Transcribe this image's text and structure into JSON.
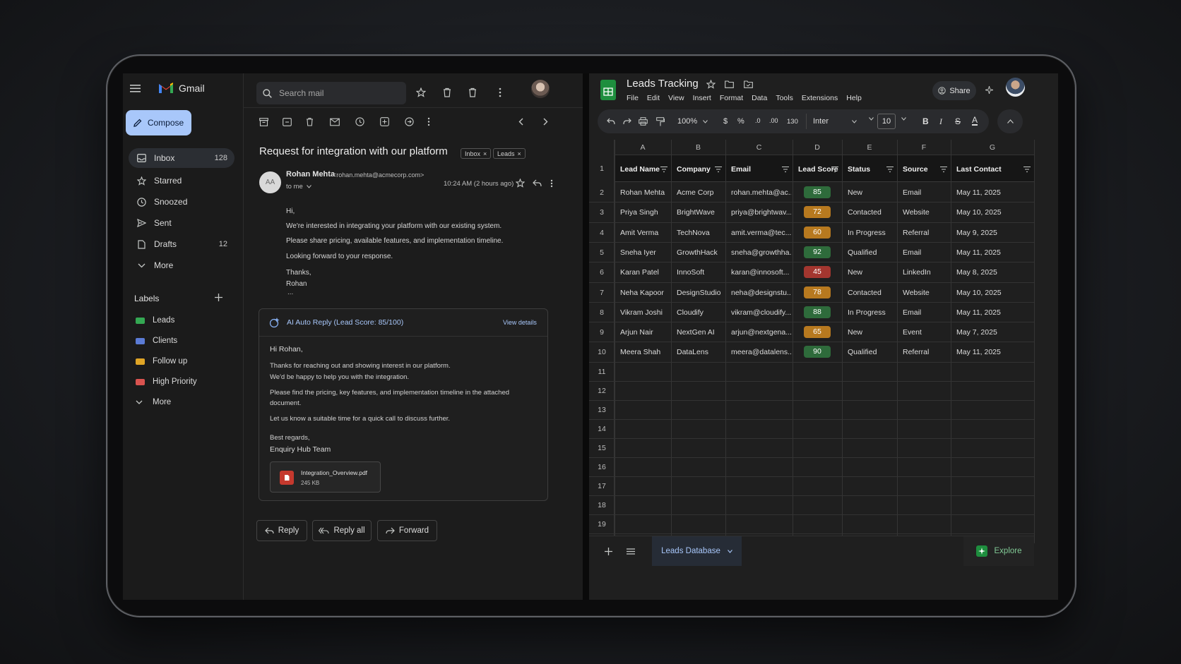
{
  "gmail": {
    "app_name": "Gmail",
    "compose_label": "Compose",
    "search_placeholder": "Search mail",
    "nav": [
      {
        "label": "Inbox",
        "count": "128",
        "icon": "inbox-icon"
      },
      {
        "label": "Starred",
        "count": "",
        "icon": "star-icon"
      },
      {
        "label": "Snoozed",
        "count": "",
        "icon": "clock-icon"
      },
      {
        "label": "Sent",
        "count": "",
        "icon": "send-icon"
      },
      {
        "label": "Drafts",
        "count": "12",
        "icon": "draft-icon"
      },
      {
        "label": "More",
        "count": "",
        "icon": "chevron-down-icon"
      }
    ],
    "labels_title": "Labels",
    "labels": [
      {
        "label": "Leads",
        "color": "#34a853"
      },
      {
        "label": "Clients",
        "color": "#5b7bd5"
      },
      {
        "label": "Follow up",
        "color": "#e0a526"
      },
      {
        "label": "High Priority",
        "color": "#d9534f"
      }
    ],
    "labels_more": "More",
    "subject": "Request for integration with our platform",
    "chips": [
      "Inbox",
      "Leads"
    ],
    "sender_initials": "AA",
    "sender_name": "Rohan Mehta",
    "sender_email": "<rohan.mehta@acmecorp.com>",
    "to_me": "to me",
    "time": "10:24 AM (2 hours ago)",
    "body": [
      "Hi,",
      "We're interested in integrating your platform with our existing system.",
      "Please share pricing, available features, and implementation timeline.",
      "Looking forward to your response.",
      "Thanks,",
      "Rohan"
    ],
    "ellipsis": "...",
    "ai_title": "AI Auto Reply (Lead Score: 85/100)",
    "ai_view": "View details",
    "ai_body": [
      "Hi Rohan,",
      "Thanks for reaching out and showing interest in our platform.",
      "We'd be happy to help you with the integration.",
      "Please find the pricing, key features, and implementation timeline in the attached",
      "document.",
      "Let us know a suitable time for a quick call to discuss further.",
      "Best regards,",
      "Enquiry Hub Team"
    ],
    "attachment_name": "Integration_Overview.pdf",
    "attachment_size": "245 KB",
    "reply": "Reply",
    "reply_all": "Reply all",
    "forward": "Forward"
  },
  "sheets": {
    "title": "Leads Tracking",
    "menu": [
      "File",
      "Edit",
      "View",
      "Insert",
      "Format",
      "Data",
      "Tools",
      "Extensions",
      "Help"
    ],
    "share": "Share",
    "zoom": "100%",
    "currency": "$",
    "percent": "%",
    "dec_less": ".0",
    "dec_more": ".00",
    "format_123": "130",
    "font": "Inter",
    "font_size": "10",
    "columns": [
      "A",
      "B",
      "C",
      "D",
      "E",
      "F",
      "G"
    ],
    "headers": [
      "Lead Name",
      "Company",
      "Email",
      "Lead Score",
      "Status",
      "Source",
      "Last Contact"
    ],
    "rows": [
      {
        "name": "Rohan Mehta",
        "company": "Acme Corp",
        "email": "rohan.mehta@ac...",
        "score": "85",
        "score_color": "#2e6b3b",
        "status": "New",
        "source": "Email",
        "last": "May 11, 2025"
      },
      {
        "name": "Priya Singh",
        "company": "BrightWave",
        "email": "priya@brightwav...",
        "score": "72",
        "score_color": "#b7791f",
        "status": "Contacted",
        "source": "Website",
        "last": "May 10, 2025"
      },
      {
        "name": "Amit Verma",
        "company": "TechNova",
        "email": "amit.verma@tec...",
        "score": "60",
        "score_color": "#b7791f",
        "status": "In Progress",
        "source": "Referral",
        "last": "May 9, 2025"
      },
      {
        "name": "Sneha Iyer",
        "company": "GrowthHack",
        "email": "sneha@growthha...",
        "score": "92",
        "score_color": "#2e6b3b",
        "status": "Qualified",
        "source": "Email",
        "last": "May 11, 2025"
      },
      {
        "name": "Karan Patel",
        "company": "InnoSoft",
        "email": "karan@innosoft...",
        "score": "45",
        "score_color": "#a3362f",
        "status": "New",
        "source": "LinkedIn",
        "last": "May 8, 2025"
      },
      {
        "name": "Neha Kapoor",
        "company": "DesignStudio",
        "email": "neha@designstu...",
        "score": "78",
        "score_color": "#b7791f",
        "status": "Contacted",
        "source": "Website",
        "last": "May 10, 2025"
      },
      {
        "name": "Vikram Joshi",
        "company": "Cloudify",
        "email": "vikram@cloudify...",
        "score": "88",
        "score_color": "#2e6b3b",
        "status": "In Progress",
        "source": "Email",
        "last": "May 11, 2025"
      },
      {
        "name": "Arjun Nair",
        "company": "NextGen AI",
        "email": "arjun@nextgena...",
        "score": "65",
        "score_color": "#b7791f",
        "status": "New",
        "source": "Event",
        "last": "May 7, 2025"
      },
      {
        "name": "Meera Shah",
        "company": "DataLens",
        "email": "meera@datalens...",
        "score": "90",
        "score_color": "#2e6b3b",
        "status": "Qualified",
        "source": "Referral",
        "last": "May 11, 2025"
      }
    ],
    "row_numbers": [
      "1",
      "2",
      "3",
      "4",
      "5",
      "6",
      "7",
      "8",
      "9",
      "10",
      "11",
      "12",
      "13",
      "14",
      "15",
      "16",
      "17",
      "18",
      "19"
    ],
    "sheet_tab": "Leads Database",
    "explore": "Explore"
  }
}
